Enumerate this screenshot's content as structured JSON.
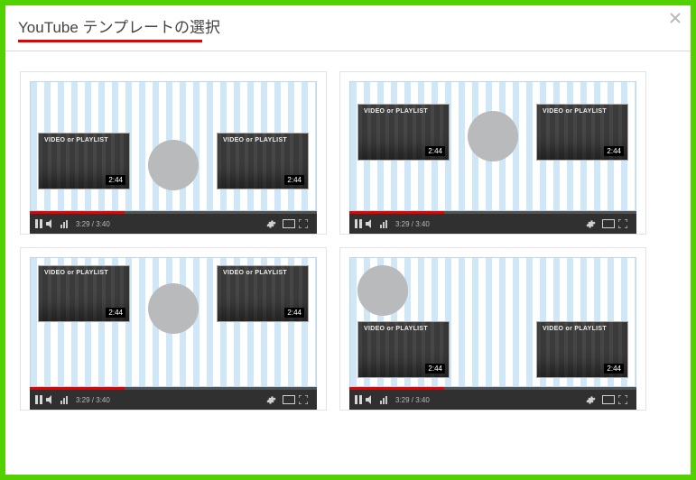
{
  "dialog": {
    "title": "YouTube テンプレートの選択",
    "close_aria": "Close"
  },
  "colors": {
    "border": "#52d000",
    "accent": "#e60000"
  },
  "thumb": {
    "label": "VIDEO or PLAYLIST",
    "time": "2:44"
  },
  "player": {
    "timecode": "3:29 / 3:40"
  },
  "templates": [
    {
      "id": "template-a",
      "layout": "A"
    },
    {
      "id": "template-b",
      "layout": "B"
    },
    {
      "id": "template-c",
      "layout": "C"
    },
    {
      "id": "template-d",
      "layout": "D"
    }
  ]
}
